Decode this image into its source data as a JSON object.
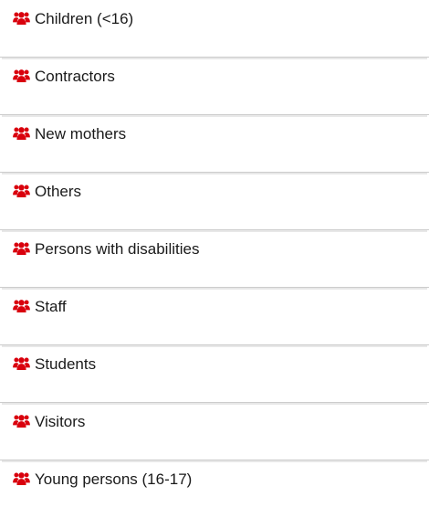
{
  "accent_color": "#d9000d",
  "group_icon": "users-icon",
  "items": [
    {
      "label": "Children (<16)"
    },
    {
      "label": "Contractors"
    },
    {
      "label": "New mothers"
    },
    {
      "label": "Others"
    },
    {
      "label": "Persons with disabilities"
    },
    {
      "label": "Staff"
    },
    {
      "label": "Students"
    },
    {
      "label": "Visitors"
    },
    {
      "label": "Young persons (16-17)"
    }
  ]
}
